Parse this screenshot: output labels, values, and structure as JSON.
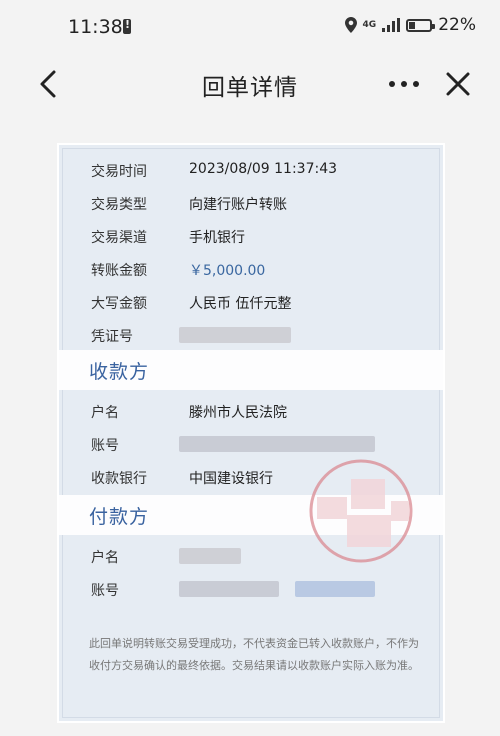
{
  "status_bar": {
    "time": "11:38",
    "network": "4G",
    "battery": "22%"
  },
  "nav": {
    "title": "回单详情"
  },
  "receipt": {
    "fields": [
      {
        "label": "交易时间",
        "value": "2023/08/09 11:37:43"
      },
      {
        "label": "交易类型",
        "value": "向建行账户转账"
      },
      {
        "label": "交易渠道",
        "value": "手机银行"
      },
      {
        "label": "转账金额",
        "value": "￥5,000.00"
      },
      {
        "label": "大写金额",
        "value": "人民币 伍仟元整"
      },
      {
        "label": "凭证号",
        "value": ""
      }
    ],
    "payee": {
      "title": "收款方",
      "name_label": "户名",
      "name": "滕州市人民法院",
      "account_label": "账号",
      "bank_label": "收款银行",
      "bank": "中国建设银行"
    },
    "payer": {
      "title": "付款方",
      "name_label": "户名",
      "account_label": "账号"
    },
    "note": "此回单说明转账交易受理成功，不代表资金已转入收款账户，不作为收付方交易确认的最终依据。交易结果请以收款账户实际入账为准。"
  },
  "colors": {
    "section_title": "#3a63a0",
    "card_bg": "#e6ecf3",
    "stamp": "#d98a92"
  }
}
